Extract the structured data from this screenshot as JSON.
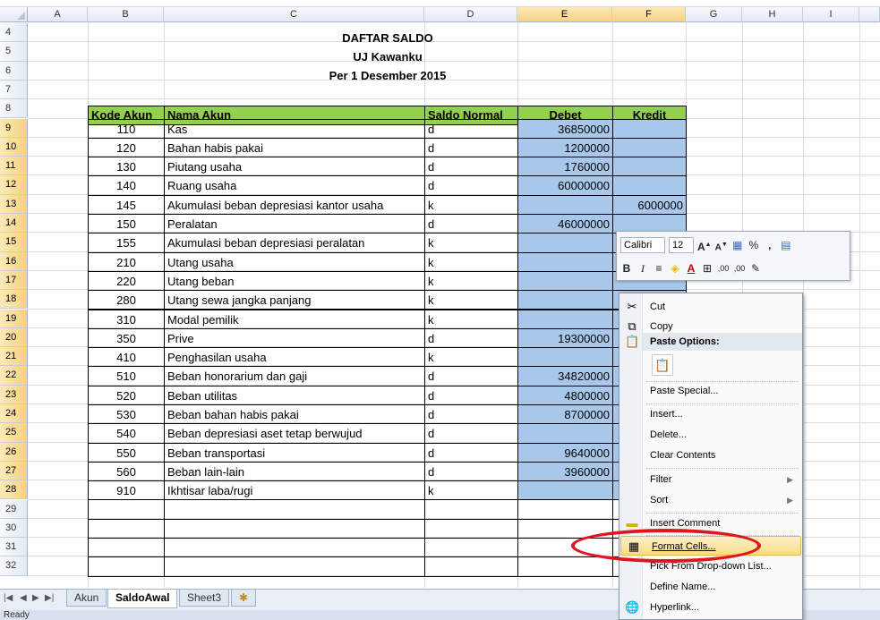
{
  "columns": [
    "A",
    "B",
    "C",
    "D",
    "E",
    "F",
    "G",
    "H",
    "I"
  ],
  "rows": [
    "4",
    "5",
    "6",
    "7",
    "8",
    "9",
    "10",
    "11",
    "12",
    "13",
    "14",
    "15",
    "16",
    "17",
    "18",
    "19",
    "20",
    "21",
    "22",
    "23",
    "24",
    "25",
    "26",
    "27",
    "28",
    "29",
    "30",
    "31",
    "32"
  ],
  "titles": [
    "DAFTAR SALDO",
    "UJ Kawanku",
    "Per 1 Desember 2015"
  ],
  "table_headers": [
    "Kode Akun",
    "Nama Akun",
    "Saldo Normal",
    "Debet",
    "Kredit"
  ],
  "table_rows": [
    {
      "kode": "110",
      "nama": "Kas",
      "saldo": "d",
      "debet": "36850000",
      "kredit": ""
    },
    {
      "kode": "120",
      "nama": "Bahan habis pakai",
      "saldo": "d",
      "debet": "1200000",
      "kredit": ""
    },
    {
      "kode": "130",
      "nama": "Piutang usaha",
      "saldo": "d",
      "debet": "1760000",
      "kredit": ""
    },
    {
      "kode": "140",
      "nama": "Ruang usaha",
      "saldo": "d",
      "debet": "60000000",
      "kredit": ""
    },
    {
      "kode": "145",
      "nama": "Akumulasi beban depresiasi kantor usaha",
      "saldo": "k",
      "debet": "",
      "kredit": "6000000"
    },
    {
      "kode": "150",
      "nama": "Peralatan",
      "saldo": "d",
      "debet": "46000000",
      "kredit": ""
    },
    {
      "kode": "155",
      "nama": "Akumulasi beban depresiasi peralatan",
      "saldo": "k",
      "debet": "",
      "kredit": ""
    },
    {
      "kode": "210",
      "nama": "Utang usaha",
      "saldo": "k",
      "debet": "",
      "kredit": ""
    },
    {
      "kode": "220",
      "nama": "Utang beban",
      "saldo": "k",
      "debet": "",
      "kredit": ""
    },
    {
      "kode": "280",
      "nama": "Utang sewa jangka panjang",
      "saldo": "k",
      "debet": "",
      "kredit": ""
    },
    {
      "kode": "310",
      "nama": "Modal pemilik",
      "saldo": "k",
      "debet": "",
      "kredit": ""
    },
    {
      "kode": "350",
      "nama": "Prive",
      "saldo": "d",
      "debet": "19300000",
      "kredit": ""
    },
    {
      "kode": "410",
      "nama": "Penghasilan usaha",
      "saldo": "k",
      "debet": "",
      "kredit": ""
    },
    {
      "kode": "510",
      "nama": "Beban honorarium dan gaji",
      "saldo": "d",
      "debet": "34820000",
      "kredit": ""
    },
    {
      "kode": "520",
      "nama": "Beban utilitas",
      "saldo": "d",
      "debet": "4800000",
      "kredit": ""
    },
    {
      "kode": "530",
      "nama": "Beban bahan habis pakai",
      "saldo": "d",
      "debet": "8700000",
      "kredit": ""
    },
    {
      "kode": "540",
      "nama": "Beban depresiasi aset tetap berwujud",
      "saldo": "d",
      "debet": "",
      "kredit": ""
    },
    {
      "kode": "550",
      "nama": "Beban transportasi",
      "saldo": "d",
      "debet": "9640000",
      "kredit": ""
    },
    {
      "kode": "560",
      "nama": "Beban lain-lain",
      "saldo": "d",
      "debet": "3960000",
      "kredit": ""
    },
    {
      "kode": "910",
      "nama": "Ikhtisar laba/rugi",
      "saldo": "k",
      "debet": "",
      "kredit": ""
    }
  ],
  "mini_toolbar": {
    "font_name": "Calibri",
    "font_size": "12",
    "percent": "%",
    "comma": ",",
    "bold": "B",
    "italic": "I",
    "font_color_glyph": "A",
    "inc_decimal": ",00",
    "dec_decimal": ",00"
  },
  "context_menu": {
    "cut": "Cut",
    "copy": "Copy",
    "paste_options": "Paste Options:",
    "paste_special": "Paste Special...",
    "insert": "Insert...",
    "delete": "Delete...",
    "clear_contents": "Clear Contents",
    "filter": "Filter",
    "sort": "Sort",
    "insert_comment": "Insert Comment",
    "format_cells": "Format Cells...",
    "pick_from_list": "Pick From Drop-down List...",
    "define_name": "Define Name...",
    "hyperlink": "Hyperlink..."
  },
  "sheet_tabs": [
    "Akun",
    "SaldoAwal",
    "Sheet3"
  ],
  "status": "Ready",
  "colors": {
    "header_green": "#92d050",
    "selection_blue": "#a7c8ea",
    "highlight_red": "#e0161e"
  }
}
